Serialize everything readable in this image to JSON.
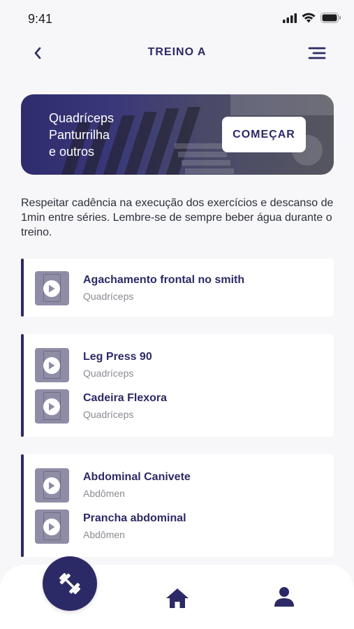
{
  "status_bar": {
    "time": "9:41"
  },
  "header": {
    "title": "TREINO A"
  },
  "banner": {
    "lines": [
      "Quadríceps",
      "Panturrilha",
      "e outros"
    ],
    "start_label": "COMEÇAR"
  },
  "description": "Respeitar cadência na execução dos exercícios e descanso de 1min entre séries. Lembre-se de sempre beber água durante o treino.",
  "groups": [
    {
      "exercises": [
        {
          "name": "Agachamento frontal no smith",
          "muscle": "Quadríceps"
        }
      ]
    },
    {
      "exercises": [
        {
          "name": "Leg Press 90",
          "muscle": "Quadríceps"
        },
        {
          "name": "Cadeira Flexora",
          "muscle": "Quadríceps"
        }
      ]
    },
    {
      "exercises": [
        {
          "name": "Abdominal Canivete",
          "muscle": "Abdômen"
        },
        {
          "name": "Prancha abdominal",
          "muscle": "Abdômen"
        }
      ]
    }
  ],
  "colors": {
    "primary": "#2c2a66",
    "background": "#f7f7f9",
    "muted": "#8b8b93"
  },
  "icons": {
    "back": "chevron-left-icon",
    "menu": "menu-icon",
    "play": "play-icon",
    "workout": "dumbbell-icon",
    "home": "home-icon",
    "profile": "user-icon"
  }
}
